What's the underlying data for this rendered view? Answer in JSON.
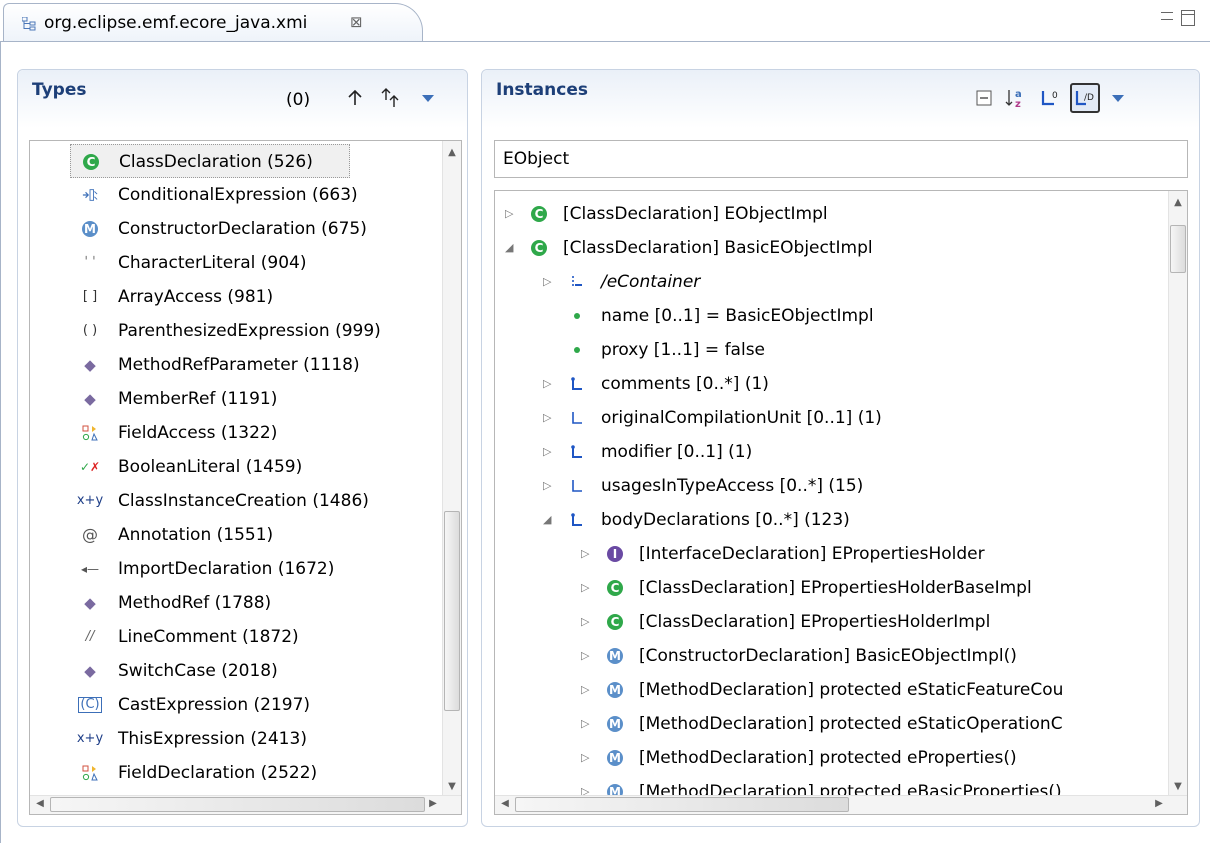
{
  "editor": {
    "tab_title": "org.eclipse.emf.ecore_java.xmi",
    "tab_icon": "tree-editor-icon",
    "close_glyph": "⊠"
  },
  "types": {
    "title": "Types",
    "count": "(0)",
    "toolbar": [
      "arrow-up-icon",
      "sort-up-icon",
      "view-menu-icon"
    ],
    "items": [
      {
        "label": "ClassDeclaration (526)",
        "icon": "class-icon"
      },
      {
        "label": "ConditionalExpression (663)",
        "icon": "conditional-icon"
      },
      {
        "label": "ConstructorDeclaration (675)",
        "icon": "method-icon"
      },
      {
        "label": "CharacterLiteral (904)",
        "icon": "quote-icon"
      },
      {
        "label": "ArrayAccess (981)",
        "icon": "brackets-icon"
      },
      {
        "label": "ParenthesizedExpression (999)",
        "icon": "parens-icon"
      },
      {
        "label": "MethodRefParameter (1118)",
        "icon": "diamond-icon"
      },
      {
        "label": "MemberRef (1191)",
        "icon": "diamond-icon"
      },
      {
        "label": "FieldAccess (1322)",
        "icon": "shapes-icon"
      },
      {
        "label": "BooleanLiteral (1459)",
        "icon": "check-cross-icon"
      },
      {
        "label": "ClassInstanceCreation (1486)",
        "icon": "xy-icon"
      },
      {
        "label": "Annotation (1551)",
        "icon": "at-icon"
      },
      {
        "label": "ImportDeclaration (1672)",
        "icon": "import-icon"
      },
      {
        "label": "MethodRef (1788)",
        "icon": "diamond-icon"
      },
      {
        "label": "LineComment (1872)",
        "icon": "comment-icon"
      },
      {
        "label": "SwitchCase (2018)",
        "icon": "diamond-icon"
      },
      {
        "label": "CastExpression (2197)",
        "icon": "cast-icon"
      },
      {
        "label": "ThisExpression (2413)",
        "icon": "xy-icon"
      },
      {
        "label": "FieldDeclaration (2522)",
        "icon": "shapes-icon"
      }
    ]
  },
  "instances": {
    "title": "Instances",
    "toolbar": [
      "collapse-all-icon",
      "sort-az-icon",
      "show-derived-icon",
      "toggle-view-icon",
      "view-menu-icon"
    ],
    "filter_value": "EObject",
    "rows": [
      {
        "label": "[ClassDeclaration] EObjectImpl",
        "icon": "class-icon",
        "indent": 0,
        "twisty": "▷"
      },
      {
        "label": "[ClassDeclaration] BasicEObjectImpl",
        "icon": "class-icon",
        "indent": 0,
        "twisty": "◢"
      },
      {
        "label": "/eContainer",
        "icon": "container-ref-icon",
        "indent": 1,
        "twisty": "▷",
        "italic": true
      },
      {
        "label": "name [0..1] = BasicEObjectImpl",
        "icon": "attribute-icon",
        "indent": 1,
        "twisty": ""
      },
      {
        "label": "proxy [1..1] = false",
        "icon": "attribute-icon",
        "indent": 1,
        "twisty": ""
      },
      {
        "label": "comments [0..*] (1)",
        "icon": "containment-ref-icon",
        "indent": 1,
        "twisty": "▷"
      },
      {
        "label": "originalCompilationUnit [0..1] (1)",
        "icon": "reference-icon",
        "indent": 1,
        "twisty": "▷"
      },
      {
        "label": "modifier [0..1] (1)",
        "icon": "containment-ref-icon",
        "indent": 1,
        "twisty": "▷"
      },
      {
        "label": "usagesInTypeAccess [0..*] (15)",
        "icon": "reference-icon",
        "indent": 1,
        "twisty": "▷"
      },
      {
        "label": "bodyDeclarations [0..*] (123)",
        "icon": "containment-ref-icon",
        "indent": 1,
        "twisty": "◢"
      },
      {
        "label": "[InterfaceDeclaration] EPropertiesHolder",
        "icon": "interface-icon",
        "indent": 2,
        "twisty": "▷"
      },
      {
        "label": "[ClassDeclaration] EPropertiesHolderBaseImpl",
        "icon": "class-icon",
        "indent": 2,
        "twisty": "▷"
      },
      {
        "label": "[ClassDeclaration] EPropertiesHolderImpl",
        "icon": "class-icon",
        "indent": 2,
        "twisty": "▷"
      },
      {
        "label": "[ConstructorDeclaration] BasicEObjectImpl()",
        "icon": "method-icon",
        "indent": 2,
        "twisty": "▷"
      },
      {
        "label": "[MethodDeclaration] protected eStaticFeatureCou",
        "icon": "method-icon",
        "indent": 2,
        "twisty": "▷"
      },
      {
        "label": "[MethodDeclaration] protected eStaticOperationC",
        "icon": "method-icon",
        "indent": 2,
        "twisty": "▷"
      },
      {
        "label": "[MethodDeclaration] protected eProperties()",
        "icon": "method-icon",
        "indent": 2,
        "twisty": "▷"
      },
      {
        "label": "[MethodDeclaration] protected eBasicProperties()",
        "icon": "method-icon",
        "indent": 2,
        "twisty": "▷"
      }
    ]
  },
  "colors": {
    "section_title": "#1d3f78",
    "class_icon": "#2fa84a",
    "method_icon": "#5b8fc9",
    "interface_icon": "#6a4aa3",
    "ref_icon": "#1f56c4"
  }
}
